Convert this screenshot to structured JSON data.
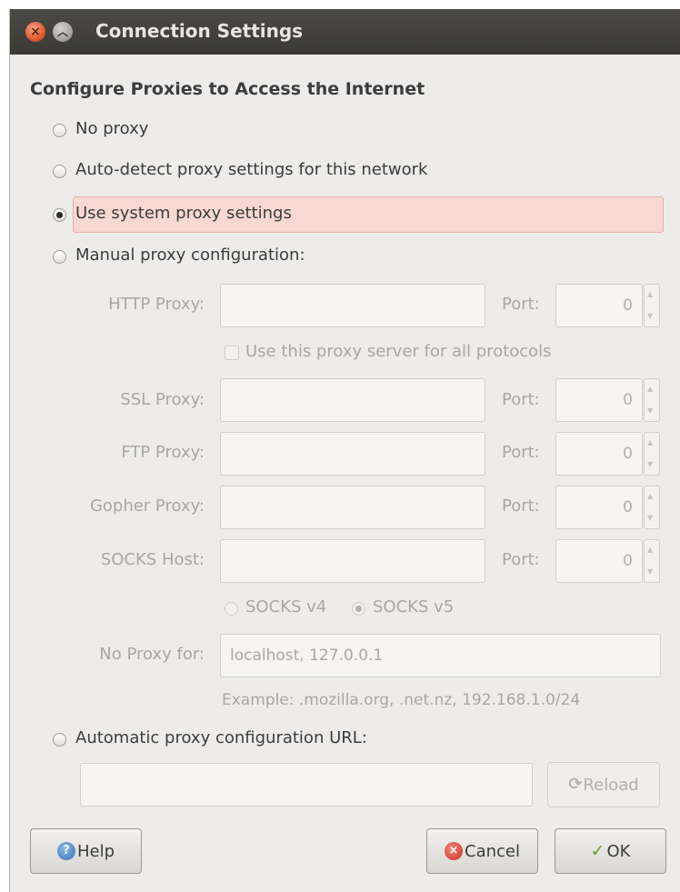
{
  "window": {
    "title": "Connection Settings"
  },
  "heading": "Configure Proxies to Access the Internet",
  "options": {
    "no_proxy": "No proxy",
    "auto_detect": "Auto-detect proxy settings for this network",
    "use_system": "Use system proxy settings",
    "manual": "Manual proxy configuration:",
    "auto_url": "Automatic proxy configuration URL:",
    "selected": "use_system"
  },
  "manual": {
    "http_label": "HTTP Proxy:",
    "http_value": "",
    "use_same_label": "Use this proxy server for all protocols",
    "ssl_label": "SSL Proxy:",
    "ftp_label": "FTP Proxy:",
    "gopher_label": "Gopher Proxy:",
    "socks_label": "SOCKS Host:",
    "port_label": "Port:",
    "ports": {
      "http": "0",
      "ssl": "0",
      "ftp": "0",
      "gopher": "0",
      "socks": "0"
    },
    "socks_v4": "SOCKS v4",
    "socks_v5": "SOCKS v5",
    "socks_selected": "v5",
    "no_proxy_label": "No Proxy for:",
    "no_proxy_value": "localhost, 127.0.0.1",
    "example": "Example: .mozilla.org, .net.nz, 192.168.1.0/24"
  },
  "auto_url": {
    "value": "",
    "reload_label": "Reload"
  },
  "buttons": {
    "help": "Help",
    "cancel": "Cancel",
    "ok": "OK"
  },
  "colors": {
    "titlebar": "#3c3b37",
    "highlight": "#f7d9d1",
    "close": "#e05a2a"
  }
}
